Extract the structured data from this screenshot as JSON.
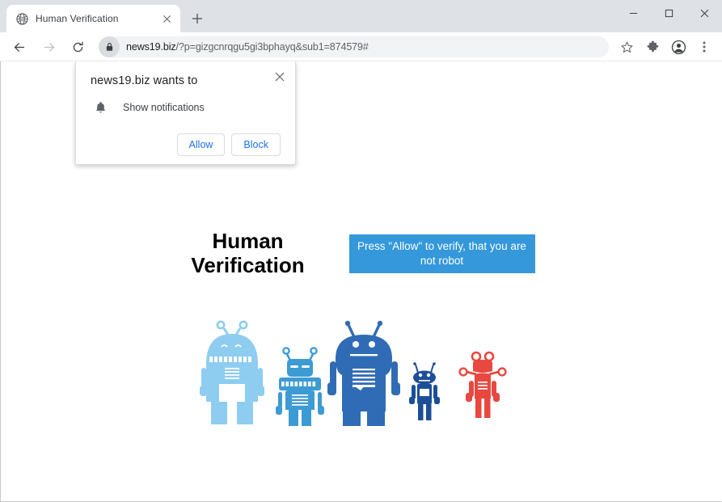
{
  "window": {
    "controls": {
      "minimize_label": "Minimize",
      "maximize_label": "Maximize",
      "close_label": "Close"
    }
  },
  "tabs": {
    "active": {
      "title": "Human Verification",
      "favicon": "globe-icon",
      "close_label": "Close tab"
    },
    "new_tab_label": "New tab"
  },
  "toolbar": {
    "back_label": "Back",
    "forward_label": "Forward",
    "reload_label": "Reload this page",
    "bookmark_label": "Bookmark this tab",
    "extensions_label": "Extensions",
    "profile_label": "Profile",
    "menu_label": "Customize and control Google Chrome",
    "omnibox": {
      "lock_icon": "lock-icon",
      "host": "news19.biz",
      "path": "/?p=gizgcnrqgu5gi3bphayq&sub1=874579#",
      "full_url": "news19.biz/?p=gizgcnrqgu5gi3bphayq&sub1=874579#"
    }
  },
  "permission_dialog": {
    "title": "news19.biz wants to",
    "permission_icon": "bell-icon",
    "permission_label": "Show notifications",
    "allow_label": "Allow",
    "block_label": "Block",
    "close_label": "Close"
  },
  "page": {
    "heading_line1": "Human",
    "heading_line2": "Verification",
    "cta_text": "Press \"Allow\" to verify, that you are not robot",
    "illustration": "robots-illustration"
  },
  "colors": {
    "cta_blue": "#3498db",
    "link_blue": "#1a73e8",
    "tabstrip_gray": "#dee1e6",
    "omnibox_gray": "#f1f3f4",
    "robot_1": "#8ecdf0",
    "robot_2": "#3d9bd4",
    "robot_3": "#2f6cb5",
    "robot_4": "#1d4f99",
    "robot_5": "#e8483f"
  }
}
